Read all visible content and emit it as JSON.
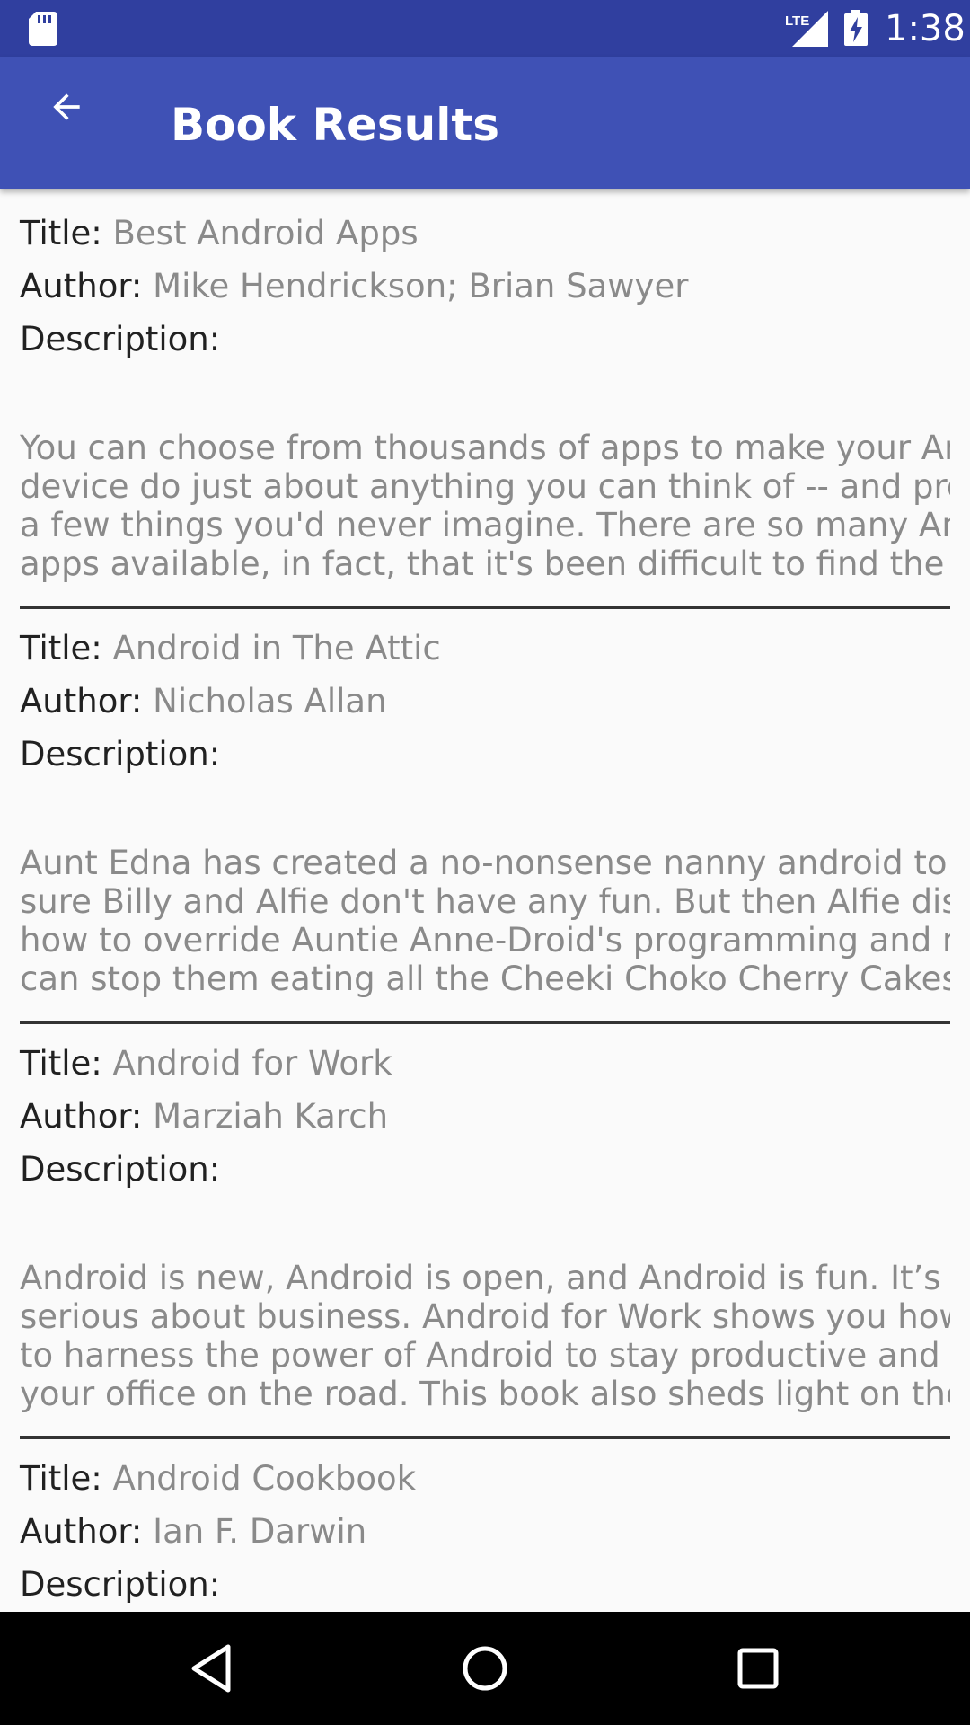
{
  "status_bar": {
    "time": "1:38",
    "network": "LTE",
    "icons": [
      "sd-card-icon",
      "lte-signal-icon",
      "battery-charging-icon"
    ]
  },
  "app_bar": {
    "title": "Book Results",
    "back_icon": "arrow-back-icon",
    "background": "#3f51b5",
    "status_background": "#303f9f"
  },
  "labels": {
    "title": "Title:",
    "author": "Author:",
    "description": "Description:"
  },
  "books": [
    {
      "title": "Best Android Apps",
      "author": "Mike Hendrickson; Brian Sawyer",
      "description_lines": [
        "You can choose from thousands of apps to make your Android",
        "device do just about anything you can think of -- and probably",
        "a few things you'd never imagine. There are so many Android",
        "apps available, in fact, that it's been difficult to find the best"
      ]
    },
    {
      "title": "Android in The Attic",
      "author": "Nicholas Allan",
      "description_lines": [
        "Aunt Edna has created a no-nonsense nanny android to make",
        "sure Billy and Alfie don't have any fun. But then Alfie discovers",
        "how to override Auntie Anne-Droid's programming and nothing",
        "can stop them eating all the Cheeki Choko Cherry Cakes they"
      ]
    },
    {
      "title": "Android for Work",
      "author": "Marziah Karch",
      "description_lines": [
        "Android is new, Android is open, and Android is fun. It’s also",
        "serious about business. Android for Work shows you how",
        "to harness the power of Android to stay productive and take",
        "your office on the road. This book also sheds light on the"
      ]
    },
    {
      "title": "Android Cookbook",
      "author": "Ian F. Darwin",
      "description_lines": []
    }
  ],
  "nav_bar": {
    "icons": [
      "back-triangle-icon",
      "home-circle-icon",
      "recents-square-icon"
    ]
  }
}
